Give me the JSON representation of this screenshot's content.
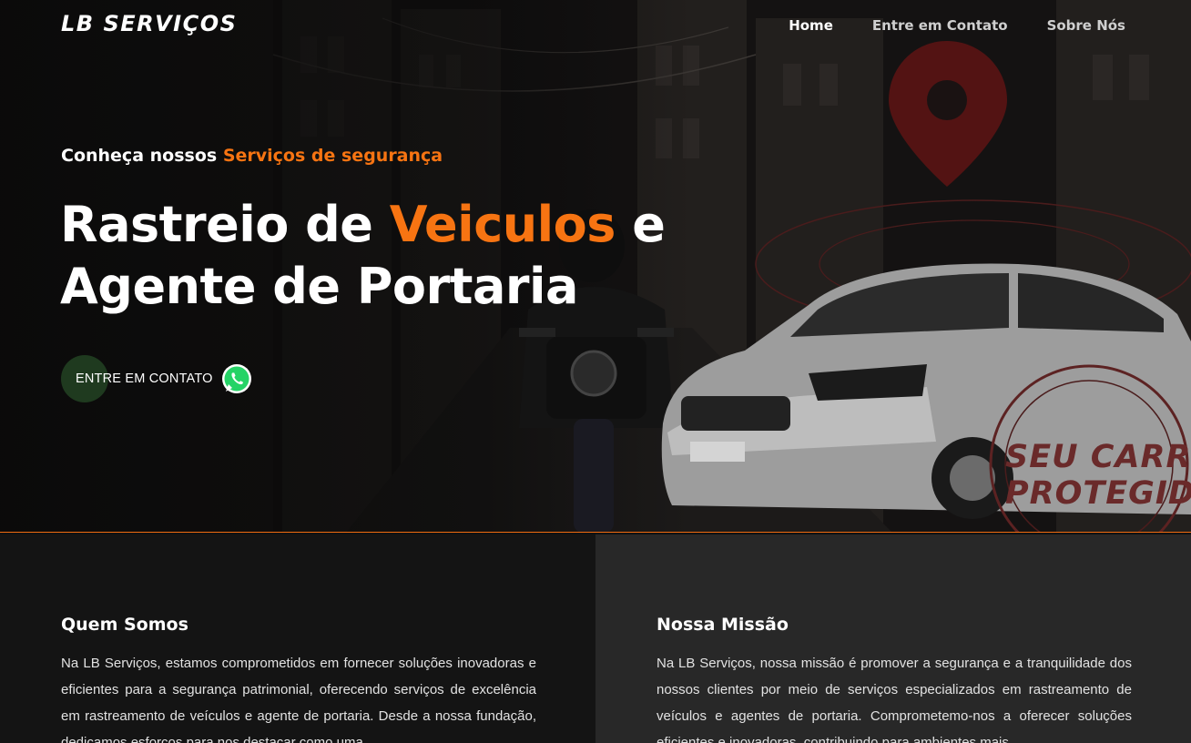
{
  "brand": {
    "logo_text": "LB SERVIÇOS"
  },
  "nav": {
    "items": [
      {
        "label": "Home",
        "active": true
      },
      {
        "label": "Entre em Contato",
        "active": false
      },
      {
        "label": "Sobre Nós",
        "active": false
      }
    ]
  },
  "hero": {
    "kicker_prefix": "Conheça nossos ",
    "kicker_accent": "Serviços de segurança",
    "headline_1": "Rastreio de ",
    "headline_accent": "Veiculos",
    "headline_2": " e",
    "headline_3": "Agente de Portaria",
    "cta_label": "ENTRE EM CONTATO",
    "stamp_line1": "SEU CARRO",
    "stamp_line2": "PROTEGIDO"
  },
  "about": {
    "left": {
      "title": "Quem Somos",
      "text": "Na LB Serviços, estamos comprometidos em fornecer soluções inovadoras e eficientes para a segurança patrimonial, oferecendo serviços de excelência em rastreamento de veículos e agente de portaria. Desde a nossa fundação, dedicamos esforços para nos destacar como uma"
    },
    "right": {
      "title": "Nossa Missão",
      "text": "Na LB Serviços, nossa missão é promover a segurança e a tranquilidade dos nossos clientes por meio de serviços especializados em rastreamento de veículos e agentes de portaria. Comprometemo-nos a oferecer soluções eficientes e inovadoras, contribuindo para ambientes mais"
    }
  },
  "colors": {
    "accent": "#f77412",
    "divider": "#f06b10",
    "whatsapp": "#25d366"
  },
  "icons": {
    "cta": "whatsapp-icon",
    "map": "map-pin-icon"
  }
}
